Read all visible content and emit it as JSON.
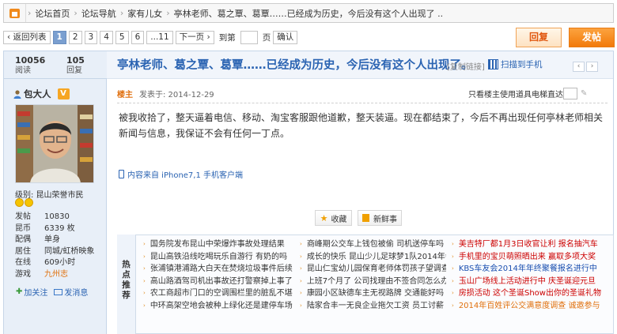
{
  "breadcrumb": {
    "items": [
      "论坛首页",
      "论坛导航",
      "家有儿女",
      "亭林老师、葛之覃、葛覃……已经成为历史，今后没有这个人出现了 .."
    ]
  },
  "pager": {
    "back_label": "‹ 返回列表",
    "pages": [
      "1",
      "2",
      "3",
      "4",
      "5",
      "6",
      "...11"
    ],
    "next_label": "下一页 ›",
    "goto_label": "到第",
    "page_unit": "页",
    "confirm_label": "确认"
  },
  "actions": {
    "reply_label": "回复",
    "post_label": "发帖"
  },
  "stats": {
    "views": "10056",
    "views_label": "阅读",
    "replies": "105",
    "replies_label": "回复"
  },
  "thread": {
    "title": "亭林老师、葛之覃、葛覃……已经成为历史，今后没有这个人出现了。",
    "copy_link": "[复制链接]",
    "phone_link": "扫描到手机"
  },
  "author": {
    "name": "包大人",
    "badge": "V",
    "level": "级别: 昆山荣誉市民",
    "profile": [
      {
        "k": "发帖",
        "v": "10830"
      },
      {
        "k": "昆币",
        "v": "6339 枚"
      },
      {
        "k": "配偶",
        "v": "单身"
      },
      {
        "k": "居住",
        "v": "同城/虹桥映象"
      },
      {
        "k": "在线",
        "v": "609小时"
      },
      {
        "k": "游戏",
        "v": "九州志"
      }
    ],
    "follow_label": "加关注",
    "message_label": "发消息"
  },
  "post": {
    "floor": "楼主",
    "posted": "发表于: 2014-12-29",
    "tools": [
      "只看楼主",
      "使用道具",
      "电梯直达"
    ],
    "body": "被我收拾了，整天逼着电信、移动、淘宝客服跟他道歉，整天装逼。现在都结束了，今后不再出现任何亭林老师相关新闻与信息，我保证不会有任何一丁点。",
    "from_phone": "内容来自 iPhone7,1 手机客户端",
    "fav_label": "收藏",
    "news_label": "新鲜事"
  },
  "hot": {
    "label": [
      "热",
      "点",
      "推",
      "荐"
    ],
    "col1": [
      "国务院发布昆山中荣爆炸事故处理结果",
      "昆山高铁沿线吃喝玩乐自游行 有奶的吗",
      "张浦镇港浦路大白天在焚烧垃圾事件后续",
      "高山路酒驾司机出事故还打警察掉上事了",
      "农工商超市门口的空调围栏里的脏乱不堪",
      "中环高架空地会被种上绿化还是建停车场"
    ],
    "col2": [
      "商峰期公交车上钱包被偷 司机送停车吗",
      "成长的快乐 昆山少儿足球梦1队2014年会",
      "昆山仁宝幼儿园保育老师体罚孩子望调查",
      "上班7个月了 公司找理由不签合同怎么办",
      "康园小区缺德车主无视路牌 交通能好吗",
      "陆家合丰一无良企业拖欠工资 员工讨薪"
    ],
    "col3": [
      {
        "t": "美吉特厂都1月3日收官让利 报名抽汽车",
        "c": "red"
      },
      {
        "t": "手机里的宝贝萌照晒出来 赢取多项大奖",
        "c": "red"
      },
      {
        "t": "KBS车友会2014年年终聚餐报名进行中",
        "c": "blue"
      },
      {
        "t": "玉山广场线上活动进行中 庆圣诞迎元旦",
        "c": "red"
      },
      {
        "t": "房损活动 这个圣诞Show出你的圣诞礼物",
        "c": "red"
      },
      {
        "t": "2014年百姓评公交满意度调查 诚邀参与",
        "c": "orange"
      }
    ]
  }
}
